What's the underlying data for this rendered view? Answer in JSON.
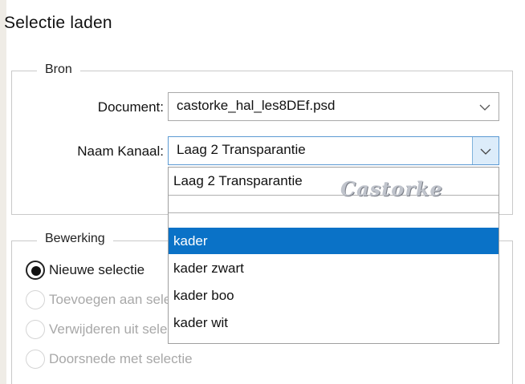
{
  "dialog": {
    "title": "Selectie laden"
  },
  "bron": {
    "label": "Bron",
    "document_label": "Document:",
    "document_value": "castorke_hal_les8DEf.psd",
    "channel_label": "Naam Kanaal:",
    "channel_value": "Laag 2 Transparantie"
  },
  "dropdown": {
    "items": [
      {
        "label": "Laag 2 Transparantie",
        "selected": false
      },
      {
        "label": "",
        "selected": false
      },
      {
        "label": "kader",
        "selected": true
      },
      {
        "label": "kader zwart",
        "selected": false
      },
      {
        "label": "kader boo",
        "selected": false
      },
      {
        "label": "kader wit",
        "selected": false
      }
    ]
  },
  "watermark": {
    "text": "Castorke"
  },
  "bewerking": {
    "label": "Bewerking",
    "options": [
      {
        "label": "Nieuwe selectie",
        "checked": true,
        "enabled": true
      },
      {
        "label": "Toevoegen aan selectie",
        "checked": false,
        "enabled": false
      },
      {
        "label": "Verwijderen uit selectie",
        "checked": false,
        "enabled": false
      },
      {
        "label": "Doorsnede met selectie",
        "checked": false,
        "enabled": false
      }
    ]
  },
  "colors": {
    "accent": "#0a72c7",
    "disabled_text": "#a8a8a8"
  }
}
